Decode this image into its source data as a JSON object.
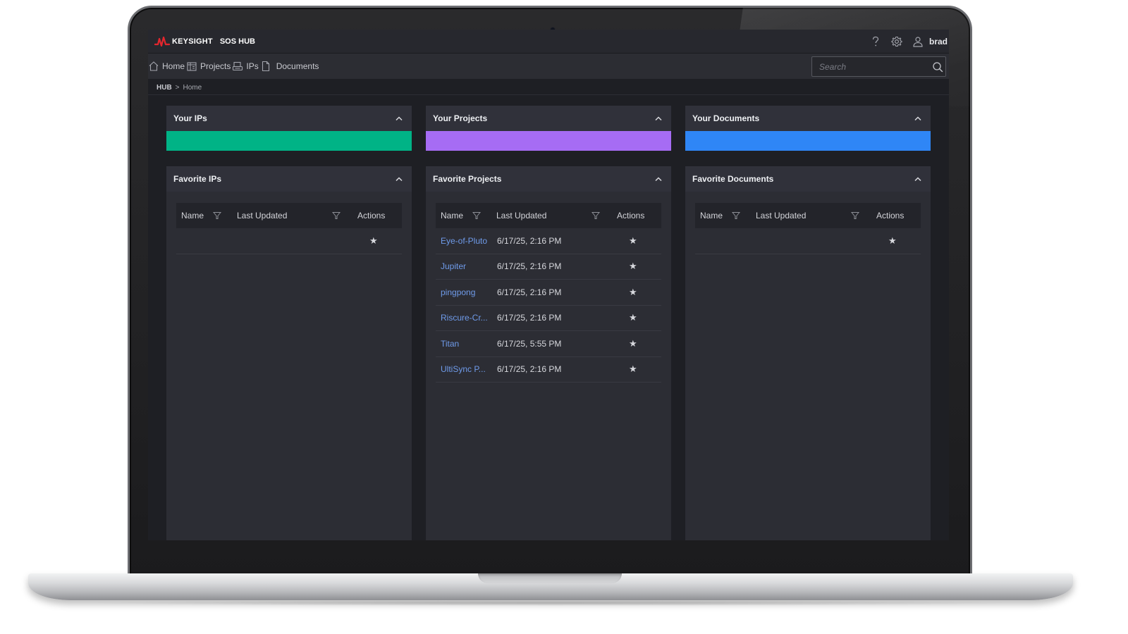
{
  "app": {
    "brand": "KEYSIGHT",
    "name": "SOS HUB",
    "username": "brad",
    "brand_color": "#e3262d"
  },
  "nav": {
    "items": [
      {
        "label": "Home",
        "icon": "home-icon"
      },
      {
        "label": "Projects",
        "icon": "projects-icon"
      },
      {
        "label": "IPs",
        "icon": "ips-icon"
      },
      {
        "label": "Documents",
        "icon": "documents-icon"
      }
    ],
    "search_placeholder": "Search"
  },
  "breadcrumb": {
    "root": "HUB",
    "separator": ">",
    "current": "Home"
  },
  "summary_panels": [
    {
      "title": "Your IPs",
      "color": "#00b386"
    },
    {
      "title": "Your Projects",
      "color": "#a66cf4"
    },
    {
      "title": "Your Documents",
      "color": "#2f86f6"
    }
  ],
  "favorites": {
    "columns": {
      "name": "Name",
      "updated": "Last Updated",
      "actions": "Actions"
    },
    "ips": {
      "title": "Favorite IPs",
      "rows": [
        {
          "name": "",
          "updated": "",
          "star": "★"
        }
      ]
    },
    "projects": {
      "title": "Favorite Projects",
      "rows": [
        {
          "name": "Eye-of-Pluto",
          "updated": "6/17/25, 2:16 PM",
          "star": "★"
        },
        {
          "name": "Jupiter",
          "updated": "6/17/25, 2:16 PM",
          "star": "★"
        },
        {
          "name": "pingpong",
          "updated": "6/17/25, 2:16 PM",
          "star": "★"
        },
        {
          "name": "Riscure-Cr...",
          "updated": "6/17/25, 2:16 PM",
          "star": "★"
        },
        {
          "name": "Titan",
          "updated": "6/17/25, 5:55 PM",
          "star": "★"
        },
        {
          "name": "UltiSync P...",
          "updated": "6/17/25, 2:16 PM",
          "star": "★"
        }
      ]
    },
    "documents": {
      "title": "Favorite Documents",
      "rows": [
        {
          "name": "",
          "updated": "",
          "star": "★"
        }
      ]
    }
  }
}
